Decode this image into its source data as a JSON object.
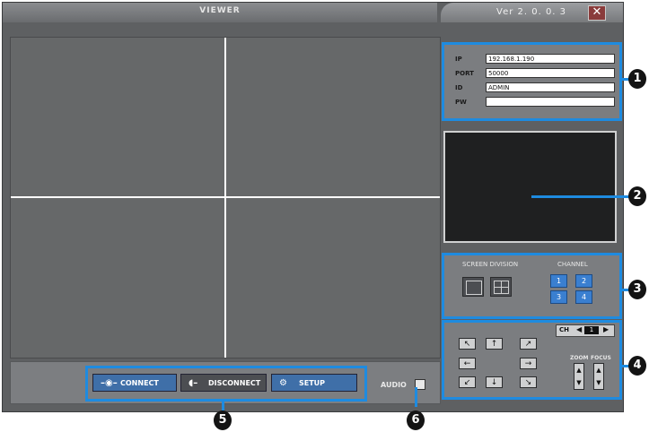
{
  "window": {
    "title": "VIEWER",
    "version": "Ver 2. 0. 0. 3",
    "close_glyph": "✕"
  },
  "login": {
    "ip_label": "IP",
    "ip_value": "192.168.1.190",
    "port_label": "PORT",
    "port_value": "50000",
    "id_label": "ID",
    "id_value": "ADMIN",
    "pw_label": "PW",
    "pw_value": ""
  },
  "division": {
    "screen_division_label": "SCREEN DIVISION",
    "channel_label": "CHANNEL",
    "channels": [
      "1",
      "2",
      "3",
      "4"
    ]
  },
  "ptz": {
    "ch_label": "CH",
    "ch_value": "1",
    "zoom_label": "ZOOM",
    "focus_label": "FOCUS"
  },
  "toolbar": {
    "connect_label": "CONNECT",
    "disconnect_label": "DISCONNECT",
    "setup_label": "SETUP",
    "audio_label": "AUDIO"
  },
  "callouts": [
    "1",
    "2",
    "3",
    "4",
    "5",
    "6"
  ],
  "colors": {
    "highlight": "#1e8be0",
    "window_bg": "#5e6062",
    "preview_bg": "#1f2021"
  }
}
